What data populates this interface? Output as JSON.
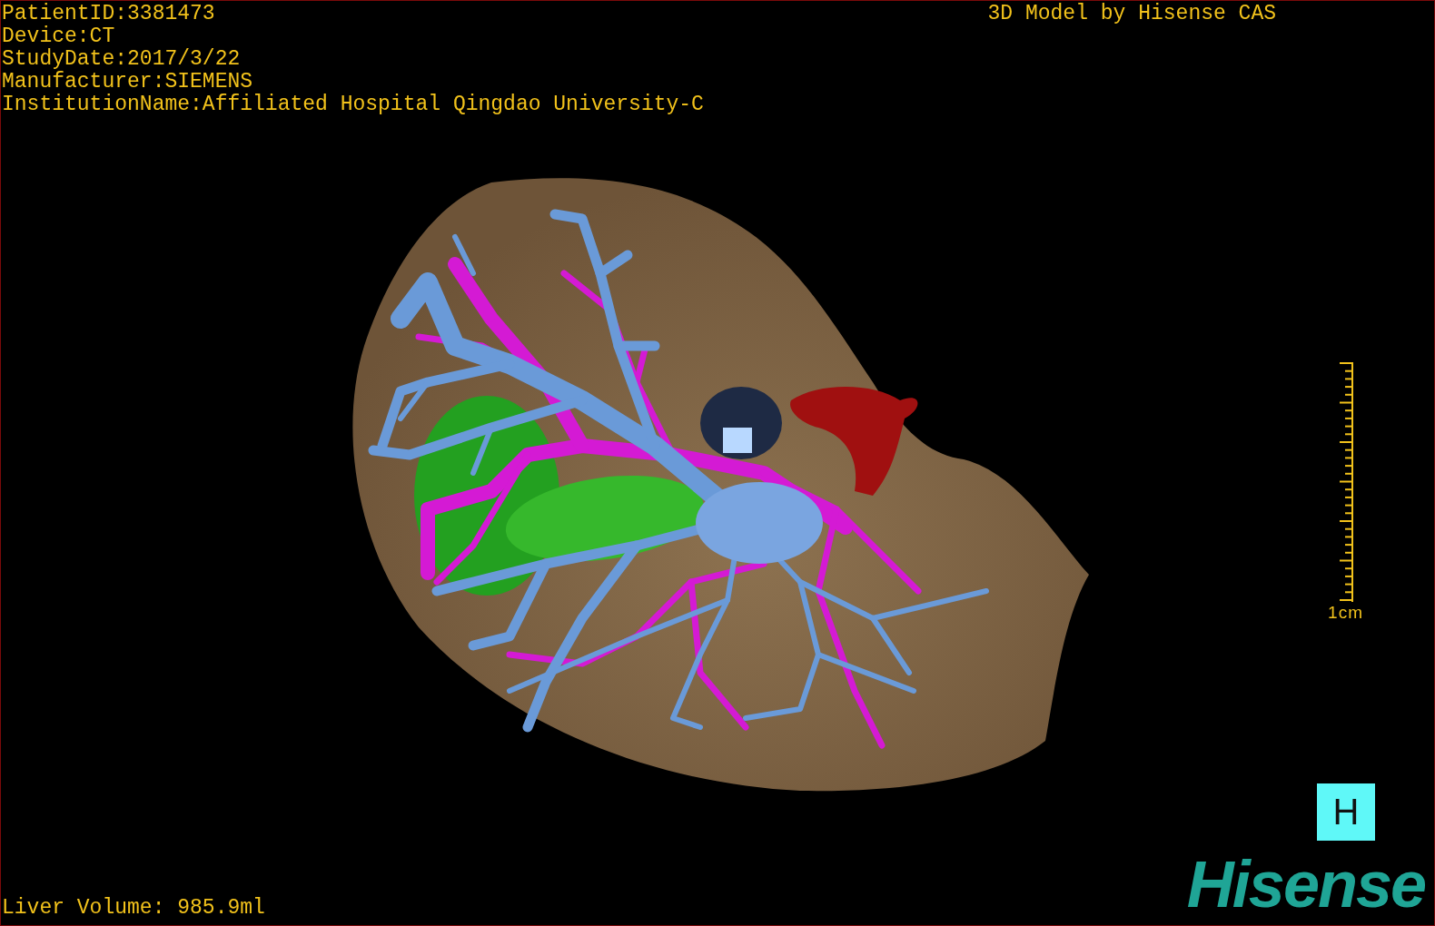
{
  "info_lines": [
    "PatientID:3381473",
    "Device:CT",
    "StudyDate:2017/3/22",
    "Manufacturer:SIEMENS",
    "InstitutionName:Affiliated Hospital Qingdao University-C"
  ],
  "credit": "3D Model by Hisense CAS",
  "scale": {
    "label": "1cm"
  },
  "view_button": {
    "label": "H"
  },
  "volume": "Liver Volume: 985.9ml",
  "logo": "Hisense"
}
